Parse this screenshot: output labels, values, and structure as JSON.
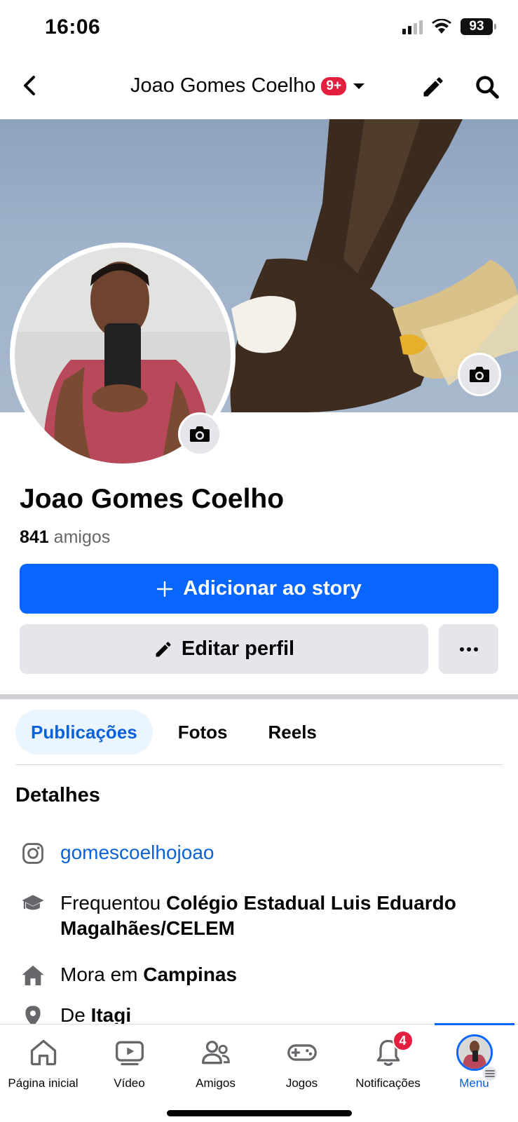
{
  "status_bar": {
    "time": "16:06",
    "battery": "93"
  },
  "header": {
    "title": "Joao Gomes Coelho",
    "badge": "9+"
  },
  "profile": {
    "name": "Joao Gomes Coelho",
    "friends_count": "841",
    "friends_label": "amigos"
  },
  "actions": {
    "add_story": "Adicionar ao story",
    "edit_profile": "Editar perfil"
  },
  "tabs": [
    {
      "label": "Publicações"
    },
    {
      "label": "Fotos"
    },
    {
      "label": "Reels"
    }
  ],
  "details": {
    "title": "Detalhes",
    "instagram": "gomescoelhojoao",
    "education_prefix": "Frequentou",
    "education_school": "Colégio Estadual Luis Eduardo Magalhães/CELEM",
    "lives_prefix": "Mora em",
    "lives_city": "Campinas",
    "from_prefix": "De",
    "from_city": "Itagi"
  },
  "bottom_nav": [
    {
      "label": "Página inicial",
      "icon": "home-icon"
    },
    {
      "label": "Vídeo",
      "icon": "video-icon"
    },
    {
      "label": "Amigos",
      "icon": "friends-icon"
    },
    {
      "label": "Jogos",
      "icon": "gamepad-icon"
    },
    {
      "label": "Notificações",
      "icon": "bell-icon",
      "badge": "4"
    },
    {
      "label": "Menu",
      "icon": "avatar"
    }
  ],
  "colors": {
    "accent": "#0866ff",
    "badge": "#e41e3f",
    "link": "#0a62d6"
  }
}
